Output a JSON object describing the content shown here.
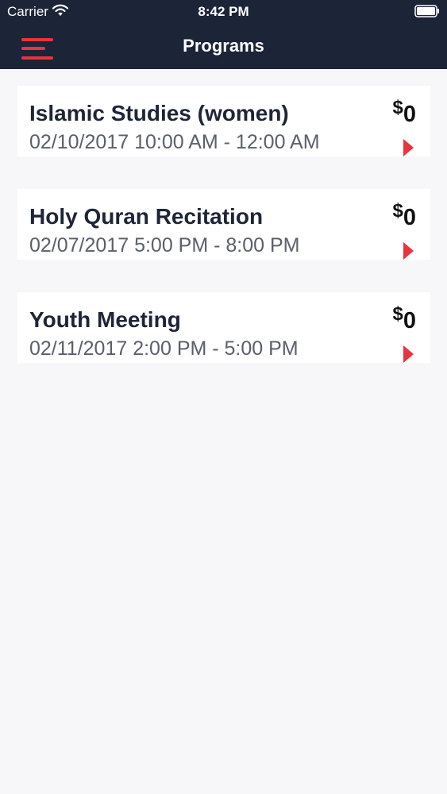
{
  "status_bar": {
    "carrier": "Carrier",
    "time": "8:42 PM",
    "icons": [
      "wifi-icon",
      "battery-icon"
    ]
  },
  "nav": {
    "title": "Programs",
    "menu_icon": "hamburger-menu-icon"
  },
  "colors": {
    "header_background": "#1c2438",
    "accent": "#e8343c",
    "page_background": "#f7f7f9",
    "card_background": "#ffffff",
    "title_text": "#1e2538",
    "subtitle_text": "#5a5f6a"
  },
  "programs": [
    {
      "name": "Islamic Studies (women)",
      "time": "02/10/2017 10:00 AM - 12:00 AM",
      "currency": "$",
      "price": "0"
    },
    {
      "name": "Holy Quran Recitation",
      "time": "02/07/2017 5:00 PM - 8:00 PM",
      "currency": "$",
      "price": "0"
    },
    {
      "name": "Youth Meeting",
      "time": "02/11/2017 2:00 PM - 5:00 PM",
      "currency": "$",
      "price": "0"
    }
  ]
}
